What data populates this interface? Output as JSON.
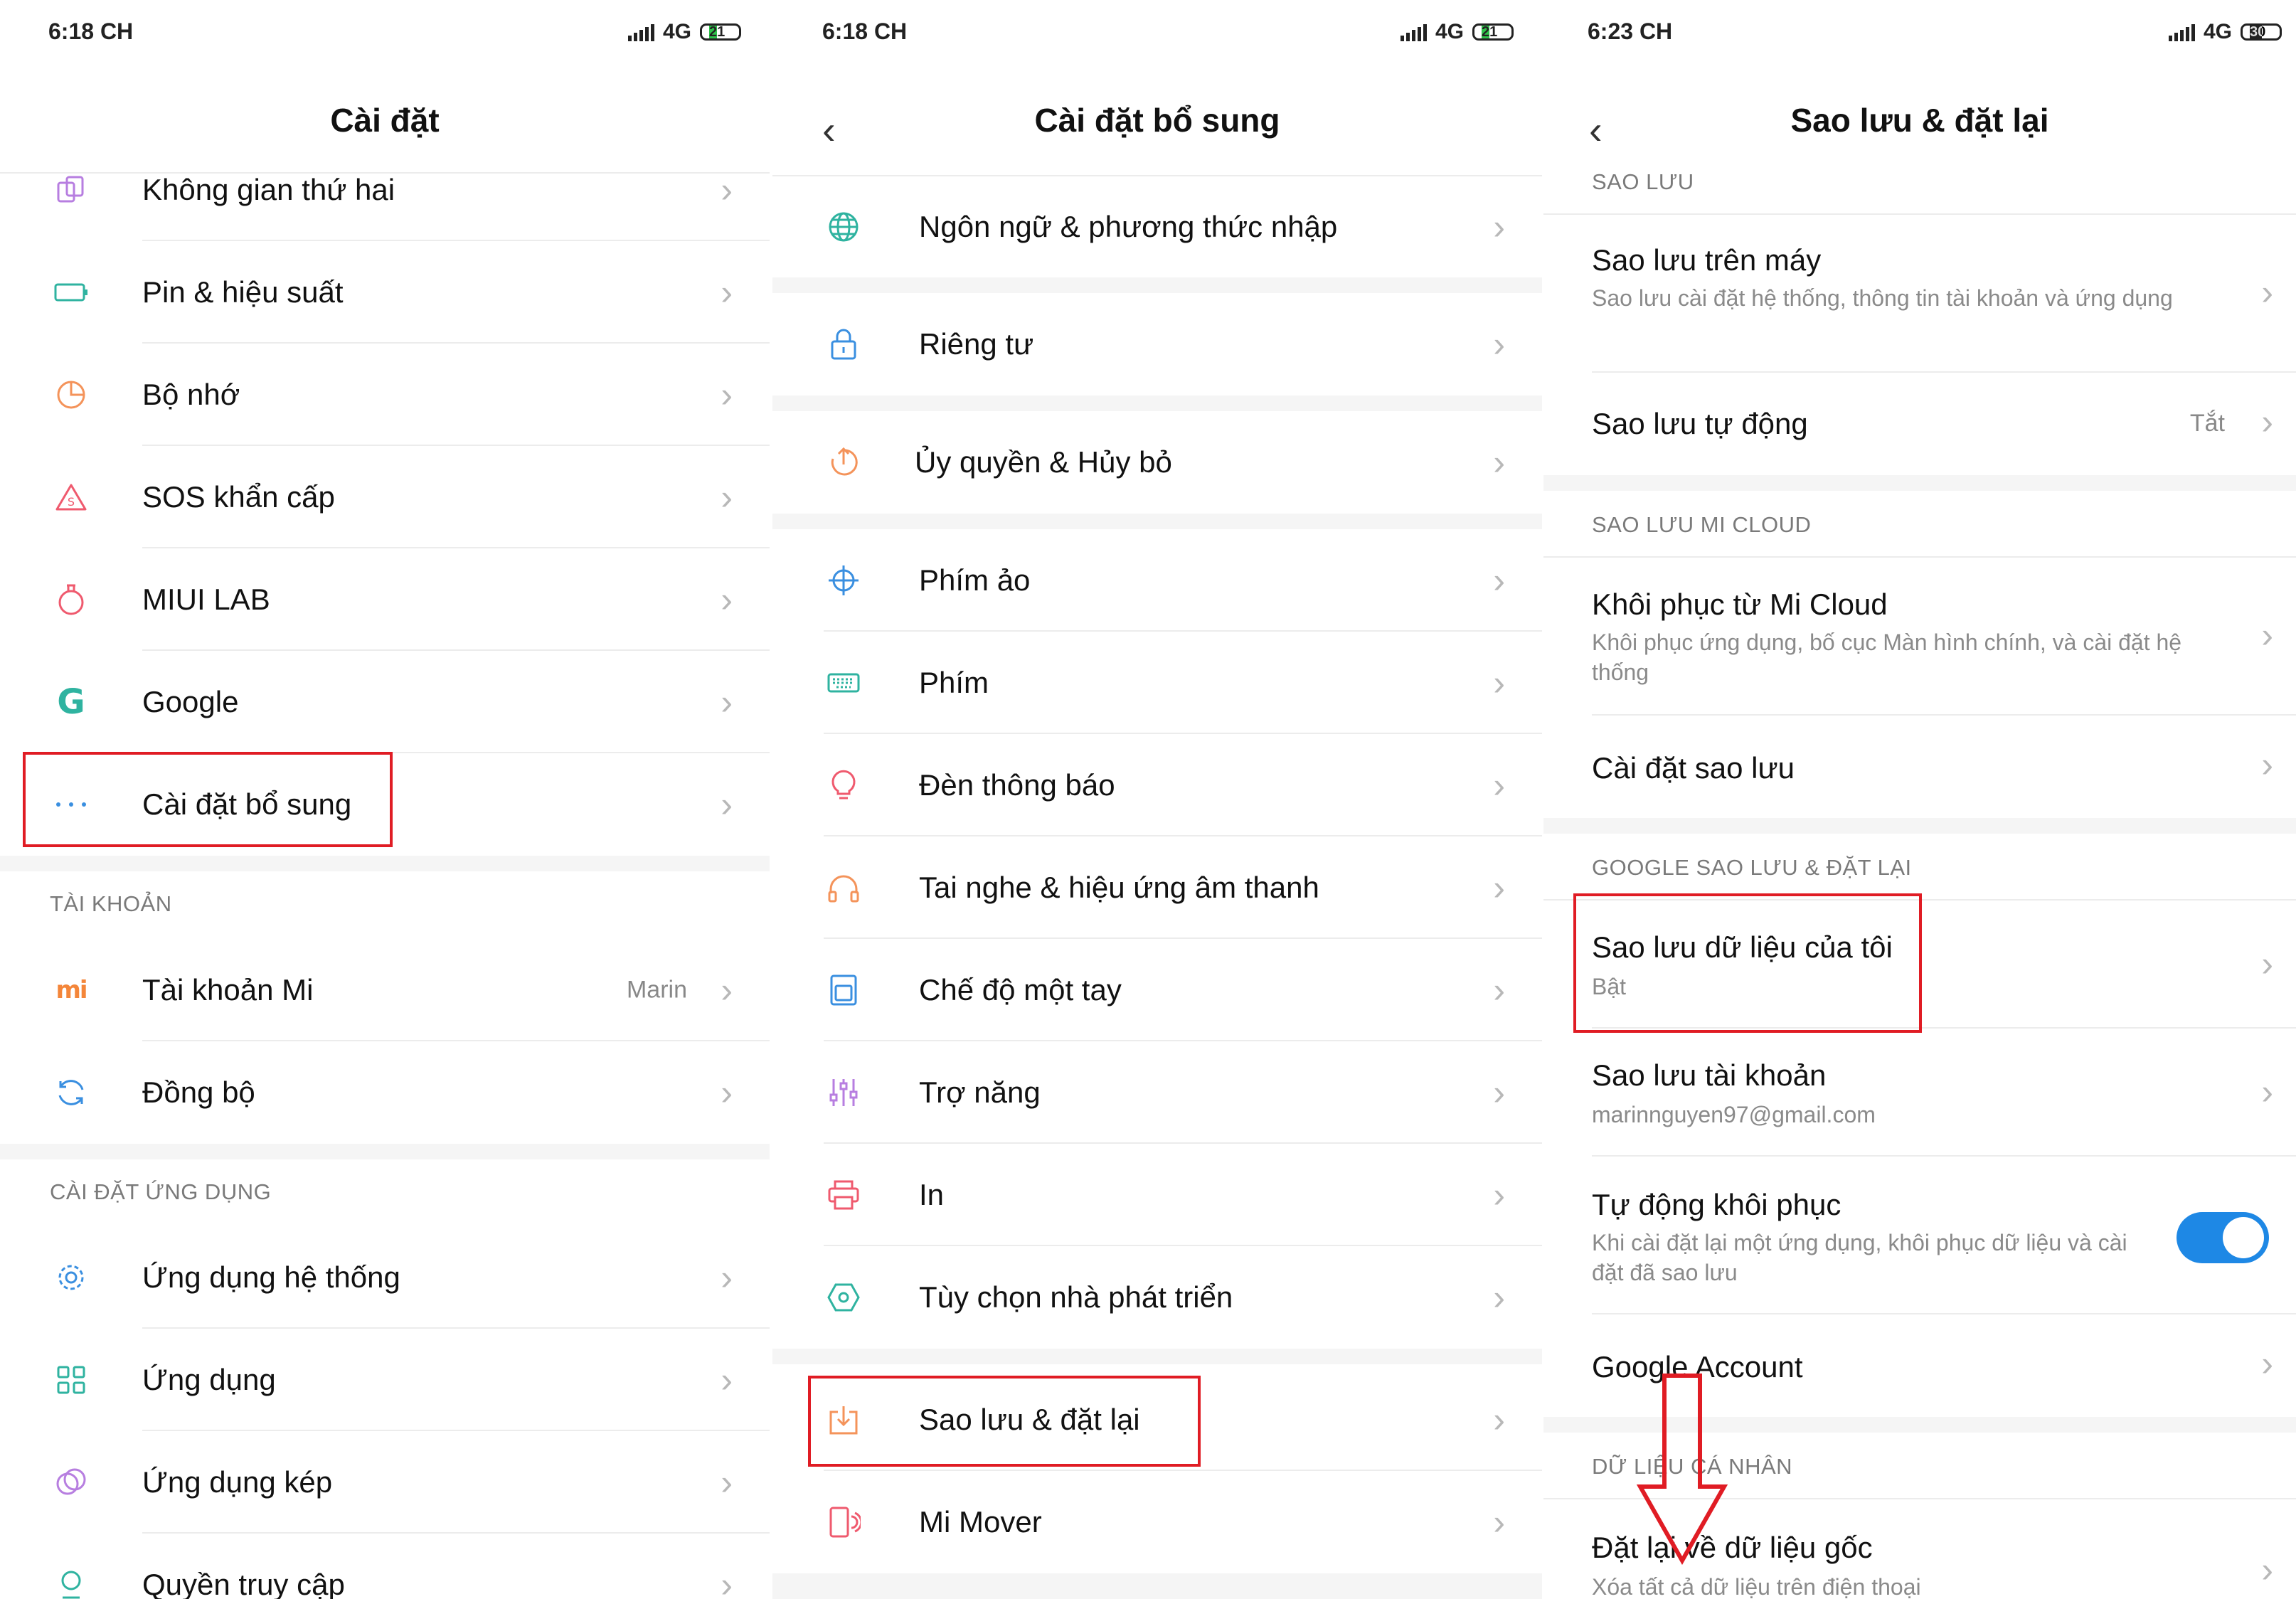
{
  "panel1": {
    "status": {
      "time": "6:18 CH",
      "network": "4G",
      "battery": "21"
    },
    "title": "Cài đặt",
    "items_top": [
      {
        "icon": "second-space-icon",
        "label": "Không gian thứ hai"
      },
      {
        "icon": "battery-icon",
        "label": "Pin & hiệu suất"
      },
      {
        "icon": "storage-icon",
        "label": "Bộ nhớ"
      },
      {
        "icon": "sos-icon",
        "label": "SOS khẩn cấp"
      },
      {
        "icon": "lab-flask-icon",
        "label": "MIUI LAB"
      },
      {
        "icon": "google-icon",
        "label": "Google"
      },
      {
        "icon": "more-dots-icon",
        "label": "Cài đặt bổ sung"
      }
    ],
    "section_account": "TÀI KHOẢN",
    "items_account": [
      {
        "icon": "mi-logo-icon",
        "label": "Tài khoản Mi",
        "value": "Marin"
      },
      {
        "icon": "sync-icon",
        "label": "Đồng bộ"
      }
    ],
    "section_apps": "CÀI ĐẶT ỨNG DỤNG",
    "items_apps": [
      {
        "icon": "gear-icon",
        "label": "Ứng dụng hệ thống"
      },
      {
        "icon": "apps-grid-icon",
        "label": "Ứng dụng"
      },
      {
        "icon": "dual-apps-icon",
        "label": "Ứng dụng kép"
      },
      {
        "icon": "permissions-icon",
        "label": "Quyền truy cập"
      }
    ]
  },
  "panel2": {
    "status": {
      "time": "6:18 CH",
      "network": "4G",
      "battery": "21"
    },
    "title": "Cài đặt bổ sung",
    "items": [
      {
        "icon": "globe-icon",
        "label": "Ngôn ngữ & phương thức nhập"
      },
      {
        "icon": "lock-icon",
        "label": "Riêng tư"
      },
      {
        "icon": "authorization-icon",
        "label": "Ủy quyền & Hủy bỏ"
      },
      {
        "icon": "crosshair-icon",
        "label": "Phím ảo"
      },
      {
        "icon": "keyboard-icon",
        "label": "Phím"
      },
      {
        "icon": "bulb-icon",
        "label": "Đèn thông báo"
      },
      {
        "icon": "headphones-icon",
        "label": "Tai nghe & hiệu ứng âm thanh"
      },
      {
        "icon": "one-hand-icon",
        "label": "Chế độ một tay"
      },
      {
        "icon": "sliders-icon",
        "label": "Trợ năng"
      },
      {
        "icon": "printer-icon",
        "label": "In"
      },
      {
        "icon": "hexagon-icon",
        "label": "Tùy chọn nhà phát triển"
      },
      {
        "icon": "backup-download-icon",
        "label": "Sao lưu & đặt lại"
      },
      {
        "icon": "phone-transfer-icon",
        "label": "Mi Mover"
      }
    ]
  },
  "panel3": {
    "status": {
      "time": "6:23 CH",
      "network": "4G",
      "battery": "30"
    },
    "title": "Sao lưu & đặt lại",
    "section_local": "SAO LƯU",
    "local_items": [
      {
        "title": "Sao lưu trên máy",
        "subtitle": "Sao lưu cài đặt hệ thống, thông tin tài khoản và ứng dụng"
      },
      {
        "title": "Sao lưu tự động",
        "value": "Tắt"
      }
    ],
    "section_cloud": "SAO LƯU MI CLOUD",
    "cloud_items": [
      {
        "title": "Khôi phục từ Mi Cloud",
        "subtitle": "Khôi phục ứng dụng, bố cục Màn hình chính, và cài đặt hệ thống"
      },
      {
        "title": "Cài đặt sao lưu"
      }
    ],
    "section_google": "GOOGLE SAO LƯU & ĐẶT LẠI",
    "google_items": [
      {
        "title": "Sao lưu dữ liệu của tôi",
        "subtitle": "Bật"
      },
      {
        "title": "Sao lưu tài khoản",
        "subtitle": "marinnguyen97@gmail.com"
      },
      {
        "title": "Tự động khôi phục",
        "subtitle": "Khi cài đặt lại một ứng dụng, khôi phục dữ liệu và cài đặt đã sao lưu",
        "toggle": true
      },
      {
        "title": "Google Account"
      }
    ],
    "section_personal": "DỮ LIỆU CÁ NHÂN",
    "personal_items": [
      {
        "title": "Đặt lại về dữ liệu gốc",
        "subtitle": "Xóa tất cả dữ liệu trên điện thoại"
      }
    ]
  },
  "colors": {
    "highlight": "#e01c24",
    "toggle_on": "#1e88e5",
    "section_bg": "#f5f5f5"
  }
}
